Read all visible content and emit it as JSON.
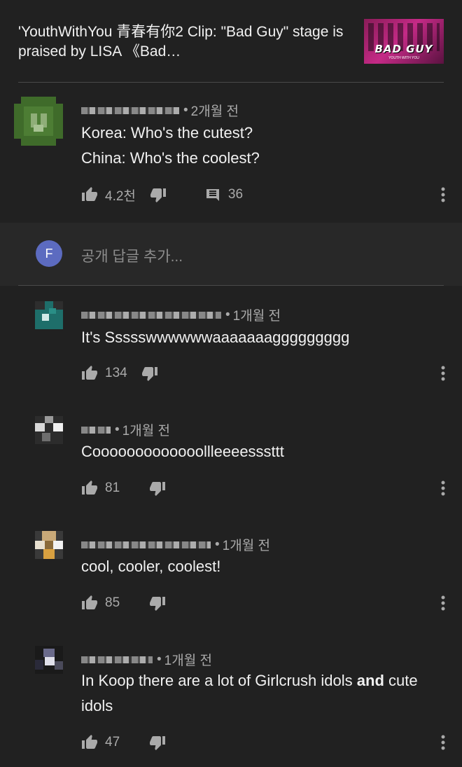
{
  "header": {
    "title": "'YouthWithYou 青春有你2 Clip: \"Bad Guy\" stage is praised by LISA 《Bad…",
    "thumbnail_text": "BAD GUY",
    "thumbnail_subtext": "YOUTH WITH YOU"
  },
  "pinned_comment": {
    "time": "2개월 전",
    "line1": "Korea: Who's the cutest?",
    "line2": "China: Who's the coolest?",
    "likes": "4.2천",
    "replies": "36"
  },
  "reply_box": {
    "avatar_letter": "F",
    "placeholder": "공개 답글 추가..."
  },
  "comments": [
    {
      "time": "1개월 전",
      "text": "It's Ssssswwwwwwaaaaaaaggggggggg",
      "likes": "134"
    },
    {
      "time": "1개월 전",
      "text": "Cooooooooooooollleeeesssttt",
      "likes": "81"
    },
    {
      "time": "1개월 전",
      "text": "cool, cooler, coolest!",
      "likes": "85"
    },
    {
      "time": "1개월 전",
      "text_pre": "In Koop there are a lot of Girlcrush idols ",
      "text_bold": "and",
      "text_post": " cute idols",
      "likes": "47"
    }
  ],
  "colors": {
    "background": "#212121",
    "reply_background": "#282828",
    "reply_avatar": "#5c6bc0",
    "secondary_text": "#aaaaaa"
  }
}
